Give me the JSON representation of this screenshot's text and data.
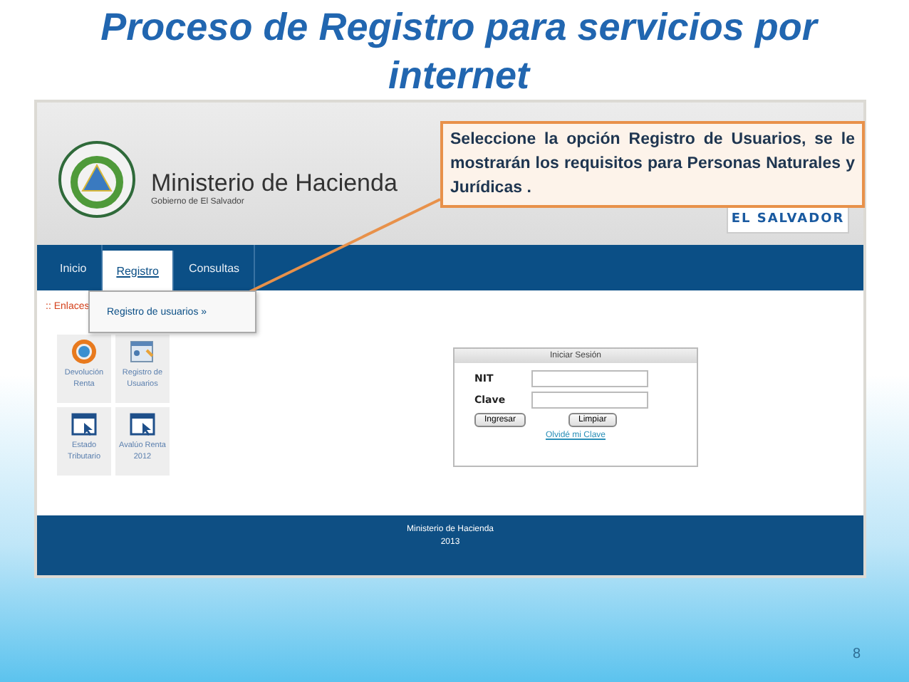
{
  "slide": {
    "title": "Proceso de Registro para servicios por internet",
    "page_number": "8"
  },
  "callout": {
    "text": "Seleccione la opción Registro de Usuarios, se le mostrarán los requisitos para Personas Naturales y Jurídicas ."
  },
  "site": {
    "name": "Ministerio de Hacienda",
    "subtitle": "Gobierno de El Salvador",
    "country_logo": "EL SALVADOR"
  },
  "nav": [
    {
      "label": "Inicio",
      "selected": false
    },
    {
      "label": "Registro",
      "selected": true
    },
    {
      "label": "Consultas",
      "selected": false
    }
  ],
  "dropdown": [
    "Registro de usuarios »"
  ],
  "links": {
    "title": ":: Enlaces",
    "items": [
      {
        "label": "Devolución Renta",
        "kind": "refresh"
      },
      {
        "label": "Registro de Usuarios",
        "kind": "form"
      },
      {
        "label": "Estado Tributario",
        "kind": "window"
      },
      {
        "label": "Avalúo Renta 2012",
        "kind": "window"
      }
    ]
  },
  "login": {
    "title": "Iniciar Sesión",
    "fields": [
      {
        "label": "NIT"
      },
      {
        "label": "Clave"
      }
    ],
    "buttons": [
      "Ingresar",
      "Limpiar"
    ],
    "forgot_link": "Olvidé mi Clave"
  },
  "footer": [
    "Ministerio de Hacienda",
    "2013"
  ]
}
